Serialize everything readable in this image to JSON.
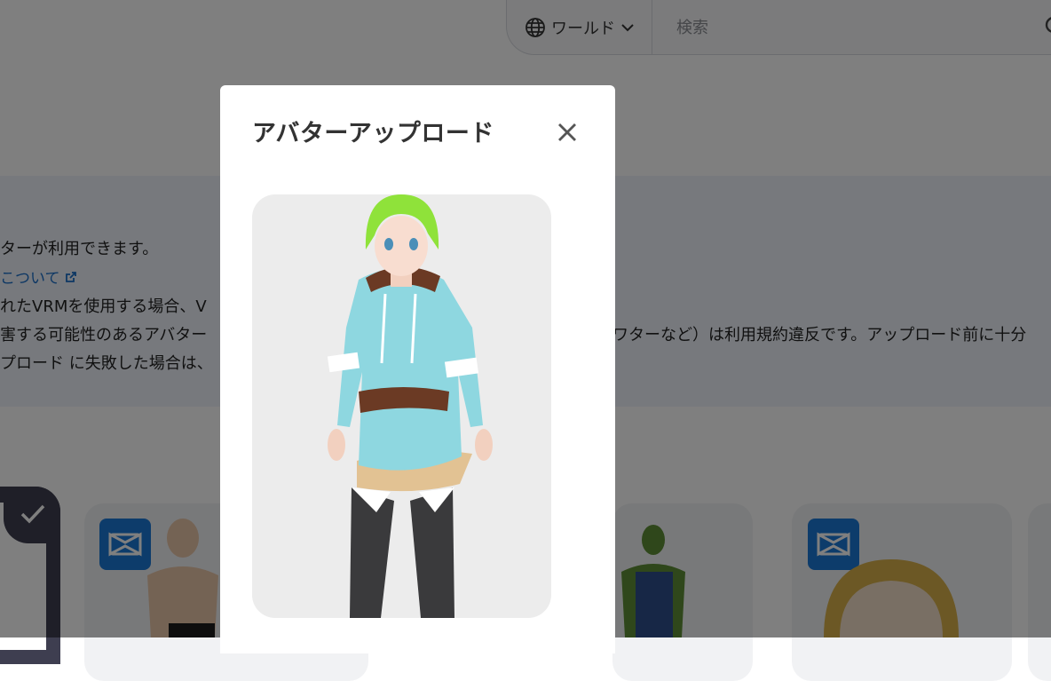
{
  "header": {
    "world_select_label": "ワールド",
    "search_placeholder": "検索"
  },
  "notice": {
    "lines": [
      "ターが利用できます。",
      "こついて",
      "れたVRMを使用する場合、V",
      "害する可能性のあるアバター",
      "ワターなど）は利用規約違反です。アップロード前に十分",
      "プロード に失敗した場合は、"
    ]
  },
  "modal": {
    "title": "アバターアップロード",
    "close_icon": "close-icon"
  },
  "icons": {
    "globe": "globe-icon",
    "chevron": "chevron-down-icon",
    "search": "search-icon",
    "external": "external-link-icon",
    "check": "check-icon",
    "vroid": "vroid-icon"
  },
  "colors": {
    "accent_blue": "#1a78d6",
    "link_blue": "#1a6fc8",
    "selected_dark": "#3e3e50",
    "overlay": "rgba(0,0,0,0.5)"
  }
}
